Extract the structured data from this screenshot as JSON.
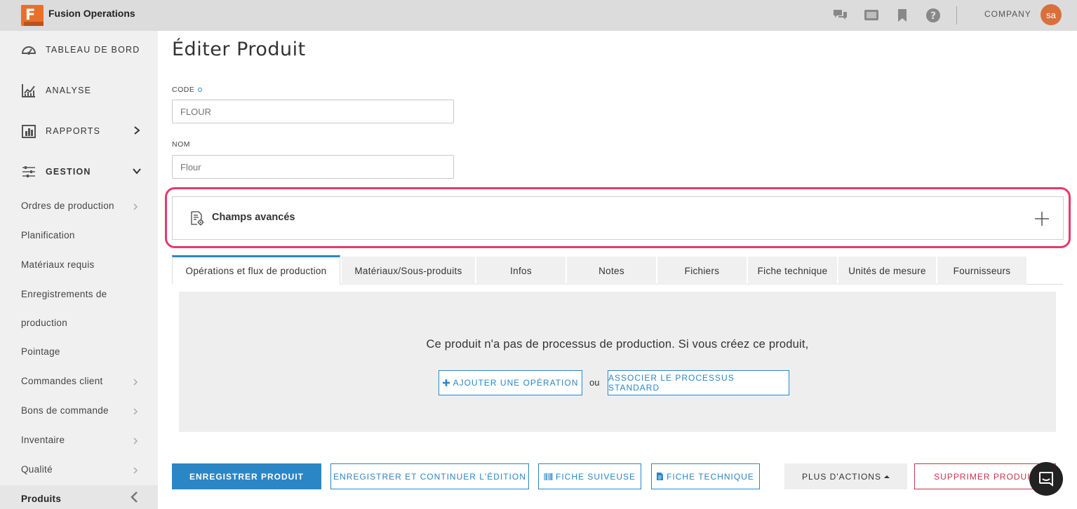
{
  "header": {
    "logo_letter": "F",
    "app_title": "Fusion Operations",
    "company": "COMPANY",
    "avatar_initials": "sa"
  },
  "sidebar": {
    "main_items": [
      {
        "label": "TABLEAU DE BORD",
        "icon": "dashboard-icon"
      },
      {
        "label": "ANALYSE",
        "icon": "chart-icon"
      },
      {
        "label": "RAPPORTS",
        "icon": "reports-icon"
      },
      {
        "label": "GESTION",
        "icon": "sliders-icon"
      }
    ],
    "sub_items": [
      {
        "label": "Ordres de production"
      },
      {
        "label": "Planification"
      },
      {
        "label": "Matériaux requis"
      },
      {
        "label": "Enregistrements de"
      },
      {
        "label": "production"
      },
      {
        "label": "Pointage"
      },
      {
        "label": "Commandes client"
      },
      {
        "label": "Bons de commande"
      },
      {
        "label": "Inventaire"
      },
      {
        "label": "Qualité"
      },
      {
        "label": "Produits"
      }
    ]
  },
  "page": {
    "title": "Éditer Produit",
    "code_label": "CODE",
    "code_placeholder": "FLOUR",
    "name_label": "NOM",
    "name_placeholder": "Flour",
    "advanced_label": "Champs avancés"
  },
  "tabs": [
    {
      "label": "Opérations et flux de production"
    },
    {
      "label": "Matériaux/Sous-produits"
    },
    {
      "label": "Infos"
    },
    {
      "label": "Notes"
    },
    {
      "label": "Fichiers"
    },
    {
      "label": "Fiche technique"
    },
    {
      "label": "Unités de mesure"
    },
    {
      "label": "Fournisseurs"
    }
  ],
  "empty_state": {
    "message": "Ce produit n'a pas de processus de production. Si vous créez ce produit,",
    "add_operation": "AJOUTER UNE OPÉRATION",
    "or": "ou",
    "associate_process": "ASSOCIER LE PROCESSUS STANDARD"
  },
  "actions": {
    "save": "ENREGISTRER PRODUIT",
    "save_continue": "ENREGISTRER ET CONTINUER L'ÉDITION",
    "tracker_sheet": "FICHE SUIVEUSE",
    "tech_sheet": "FICHE TECHNIQUE",
    "more_actions": "PLUS D'ACTIONS",
    "delete": "SUPPRIMER PRODUIT"
  },
  "colors": {
    "accent": "#2b86c5",
    "brand": "#e8702a",
    "danger": "#c8334a",
    "highlight": "#e63a6b"
  }
}
